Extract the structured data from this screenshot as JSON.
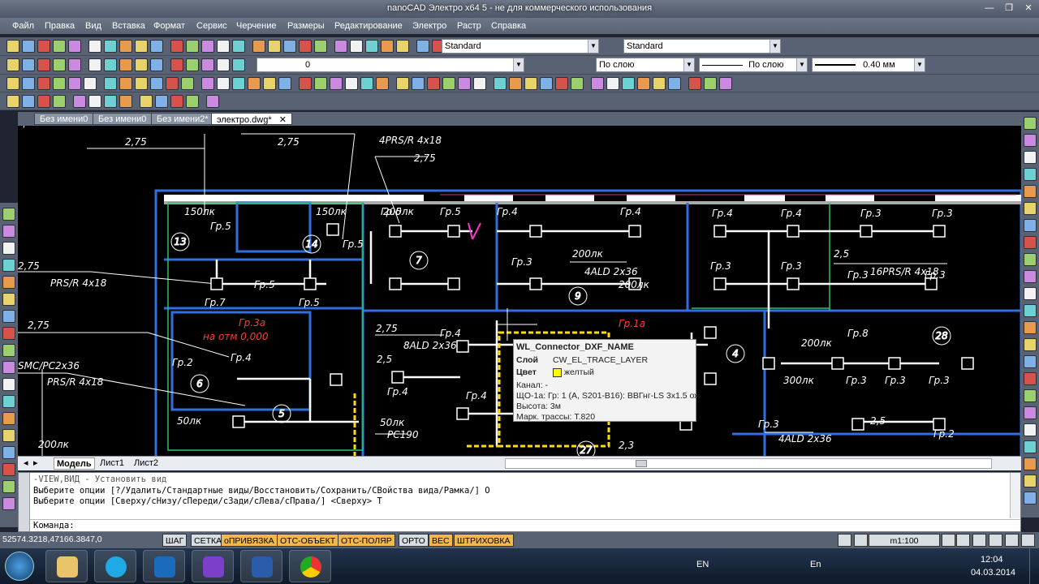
{
  "window": {
    "title": "nanoCAD Электро x64 5 - не для коммерческого использования"
  },
  "menu": [
    "Файл",
    "Правка",
    "Вид",
    "Вставка",
    "Формат",
    "Сервис",
    "Черчение",
    "Размеры",
    "Редактирование",
    "Электро",
    "Растр",
    "Справка"
  ],
  "toolbar": {
    "text_style": "Standard",
    "dim_style": "Standard",
    "layer": "0",
    "color": "По слою",
    "linetype": "По слою",
    "lineweight": "0.40 мм"
  },
  "doc_tabs": [
    {
      "label": "Без имени0"
    },
    {
      "label": "Без имени0"
    },
    {
      "label": "Без имени2*"
    },
    {
      "label": "электро.dwg*"
    }
  ],
  "layout_tabs": [
    "Модель",
    "Лист1",
    "Лист2"
  ],
  "command": {
    "lines": [
      "-VIEW,ВИД - Установить вид",
      "Выберите опции [?/Удалить/Стандартные виды/Восстановить/Сохранить/СВойства вида/Рамка/] О",
      "Выберите опции [Сверху/сНизу/сПереди/сЗади/сЛева/сПрава/] <Сверху> Т"
    ],
    "prompt": "Команда:",
    "side_label": "Команды"
  },
  "status": {
    "coords": "52574.3218,47166.3847,0",
    "buttons": [
      {
        "label": "ШАГ",
        "on": false
      },
      {
        "label": "СЕТКА",
        "on": false
      },
      {
        "label": "оПРИВЯЗКА",
        "on": true
      },
      {
        "label": "ОТС-ОБЪЕКТ",
        "on": true
      },
      {
        "label": "ОТС-ПОЛЯР",
        "on": true
      },
      {
        "label": "ОРТО",
        "on": false
      },
      {
        "label": "ВЕС",
        "on": true
      },
      {
        "label": "ШТРИХОВКА",
        "on": true
      }
    ],
    "scale": "m1:100"
  },
  "tooltip": {
    "title": "WL_Connector_DXF_NAME",
    "layer_label": "Слой",
    "layer_value": "CW_EL_TRACE_LAYER",
    "color_label": "Цвет",
    "color_value": "желтый",
    "color_swatch": "#ffff00",
    "lines": [
      "Канал: -",
      "ЩО-1а: Гр: 1 (А, S201-B16): ВВГнг-LS 3x1.5 ож",
      "Высота: 3м",
      "Марк. трассы: Т.820"
    ]
  },
  "taskbar": {
    "lang": "EN",
    "tray_lang": "En",
    "time": "12:04",
    "date": "04.03.2014"
  },
  "drawing": {
    "labels_white": [
      "4PRS/R 4x18",
      "2,75",
      "2,75",
      "2,75",
      "150лк",
      "150лк",
      "Гр.5",
      "Гр.5",
      "Гр.5",
      "Гр.5",
      "Гр.5",
      "Гр.7",
      "Гр.5",
      "Гр.4",
      "Гр.4",
      "Гр.4",
      "Гр.4",
      "Гр.3",
      "Гр.3",
      "Гр.3",
      "Гр.3",
      "Гр.3",
      "Гр.3",
      "Гр.3",
      "200лк",
      "200лк",
      "200лк",
      "4ALD 2x36",
      "2,5",
      "16PRS/R 4x18",
      "2,75",
      "PRS/R 4x18",
      "2,75",
      "SMC/PC2x36",
      "PRS/R 4x18",
      "2,75",
      "8ALD 2x36",
      "2,5",
      "Гр.4",
      "Гр.4",
      "Гр.4",
      "200лк",
      "Гр.8",
      "300лк",
      "Гр.3",
      "Гр.3",
      "Гр.3",
      "Гр.3",
      "4ALD 2x36",
      "2,5",
      "Гр.2",
      "Гр.2",
      "50лк",
      "50лк",
      "PC190",
      "2,3",
      "200лк",
      "Гр.1",
      "Гр.4",
      "Гр.5"
    ],
    "labels_red": [
      "Гр.3а",
      "на отм 0,000",
      "Гр.1а"
    ],
    "room_numbers": [
      "13",
      "14",
      "7",
      "9",
      "6",
      "5",
      "4",
      "28",
      "27"
    ]
  }
}
